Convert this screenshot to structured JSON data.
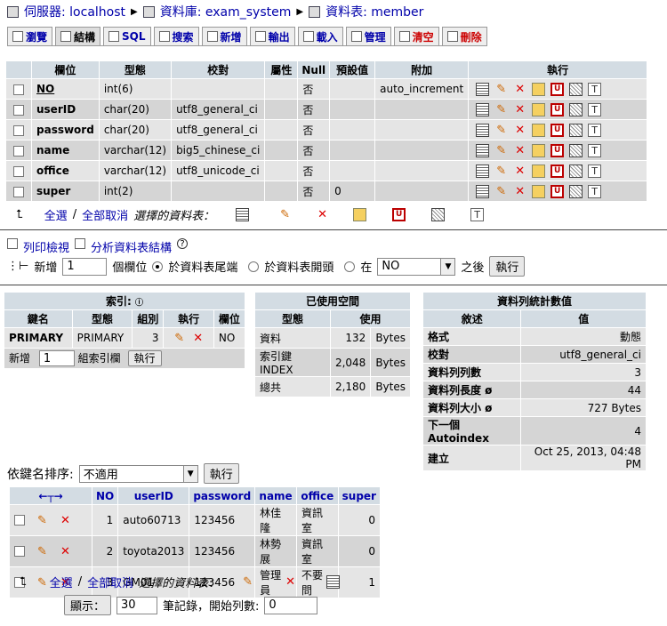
{
  "breadcrumb": {
    "server": "伺服器: localhost",
    "database": "資料庫: exam_system",
    "table": "資料表: member"
  },
  "tabs": [
    "瀏覽",
    "結構",
    "SQL",
    "搜索",
    "新增",
    "輸出",
    "載入",
    "管理",
    "清空",
    "刪除"
  ],
  "structure": {
    "headers": [
      "",
      "欄位",
      "型態",
      "校對",
      "屬性",
      "Null",
      "預設值",
      "附加",
      "執行"
    ],
    "rows": [
      {
        "name": "NO",
        "type": "int(6)",
        "collation": "",
        "attr": "",
        "null": "否",
        "default": "",
        "extra": "auto_increment"
      },
      {
        "name": "userID",
        "type": "char(20)",
        "collation": "utf8_general_ci",
        "attr": "",
        "null": "否",
        "default": "",
        "extra": ""
      },
      {
        "name": "password",
        "type": "char(20)",
        "collation": "utf8_general_ci",
        "attr": "",
        "null": "否",
        "default": "",
        "extra": ""
      },
      {
        "name": "name",
        "type": "varchar(12)",
        "collation": "big5_chinese_ci",
        "attr": "",
        "null": "否",
        "default": "",
        "extra": ""
      },
      {
        "name": "office",
        "type": "varchar(12)",
        "collation": "utf8_unicode_ci",
        "attr": "",
        "null": "否",
        "default": "",
        "extra": ""
      },
      {
        "name": "super",
        "type": "int(2)",
        "collation": "",
        "attr": "",
        "null": "否",
        "default": "0",
        "extra": ""
      }
    ],
    "select_all": "全選",
    "deselect_all": "全部取消",
    "with_selected": "選擇的資料表："
  },
  "links": {
    "print_view": "列印檢視",
    "analyze": "分析資料表結構"
  },
  "add_field": {
    "label": "新增",
    "count": "1",
    "unit": "個欄位",
    "at_end": "於資料表尾端",
    "at_begin": "於資料表開頭",
    "after": "在",
    "after_field": "NO",
    "after_suffix": "之後",
    "go": "執行"
  },
  "indexes": {
    "title": "索引:",
    "headers": [
      "鍵名",
      "型態",
      "組別",
      "執行",
      "欄位"
    ],
    "row": {
      "key": "PRIMARY",
      "type": "PRIMARY",
      "cardinality": "3",
      "field": "NO"
    },
    "add_label": "新增",
    "add_count": "1",
    "add_suffix": "組索引欄",
    "go": "執行"
  },
  "space": {
    "title": "已使用空間",
    "headers": [
      "型態",
      "使用"
    ],
    "rows": [
      {
        "label": "資料",
        "value": "132",
        "unit": "Bytes"
      },
      {
        "label": "索引鍵 INDEX",
        "value": "2,048",
        "unit": "Bytes"
      },
      {
        "label": "總共",
        "value": "2,180",
        "unit": "Bytes"
      }
    ]
  },
  "stats": {
    "title": "資料列統計數值",
    "headers": [
      "敘述",
      "值"
    ],
    "rows": [
      {
        "label": "格式",
        "value": "動態"
      },
      {
        "label": "校對",
        "value": "utf8_general_ci"
      },
      {
        "label": "資料列列數",
        "value": "3"
      },
      {
        "label": "資料列長度 ø",
        "value": "44"
      },
      {
        "label": "資料列大小 ø",
        "value": "727 Bytes"
      },
      {
        "label": "下一個 Autoindex",
        "value": "4"
      },
      {
        "label": "建立",
        "value": "Oct 25, 2013, 04:48 PM"
      }
    ]
  },
  "browse": {
    "sort_label": "依鍵名排序:",
    "sort_value": "不適用",
    "go": "執行",
    "headers": [
      "NO",
      "userID",
      "password",
      "name",
      "office",
      "super"
    ],
    "rows": [
      [
        "1",
        "auto60713",
        "123456",
        "林佳隆",
        "資訊室",
        "0"
      ],
      [
        "2",
        "toyota2013",
        "123456",
        "林勢展",
        "資訊室",
        "0"
      ],
      [
        "3",
        "GM01",
        "123456",
        "管理員",
        "不要問",
        "1"
      ]
    ],
    "select_all": "全選",
    "deselect_all": "全部取消",
    "with_selected": "選擇的資料表：",
    "show_button": "顯示：",
    "show_count": "30",
    "records_label": "筆記錄，開始列數:",
    "start_row": "0"
  }
}
